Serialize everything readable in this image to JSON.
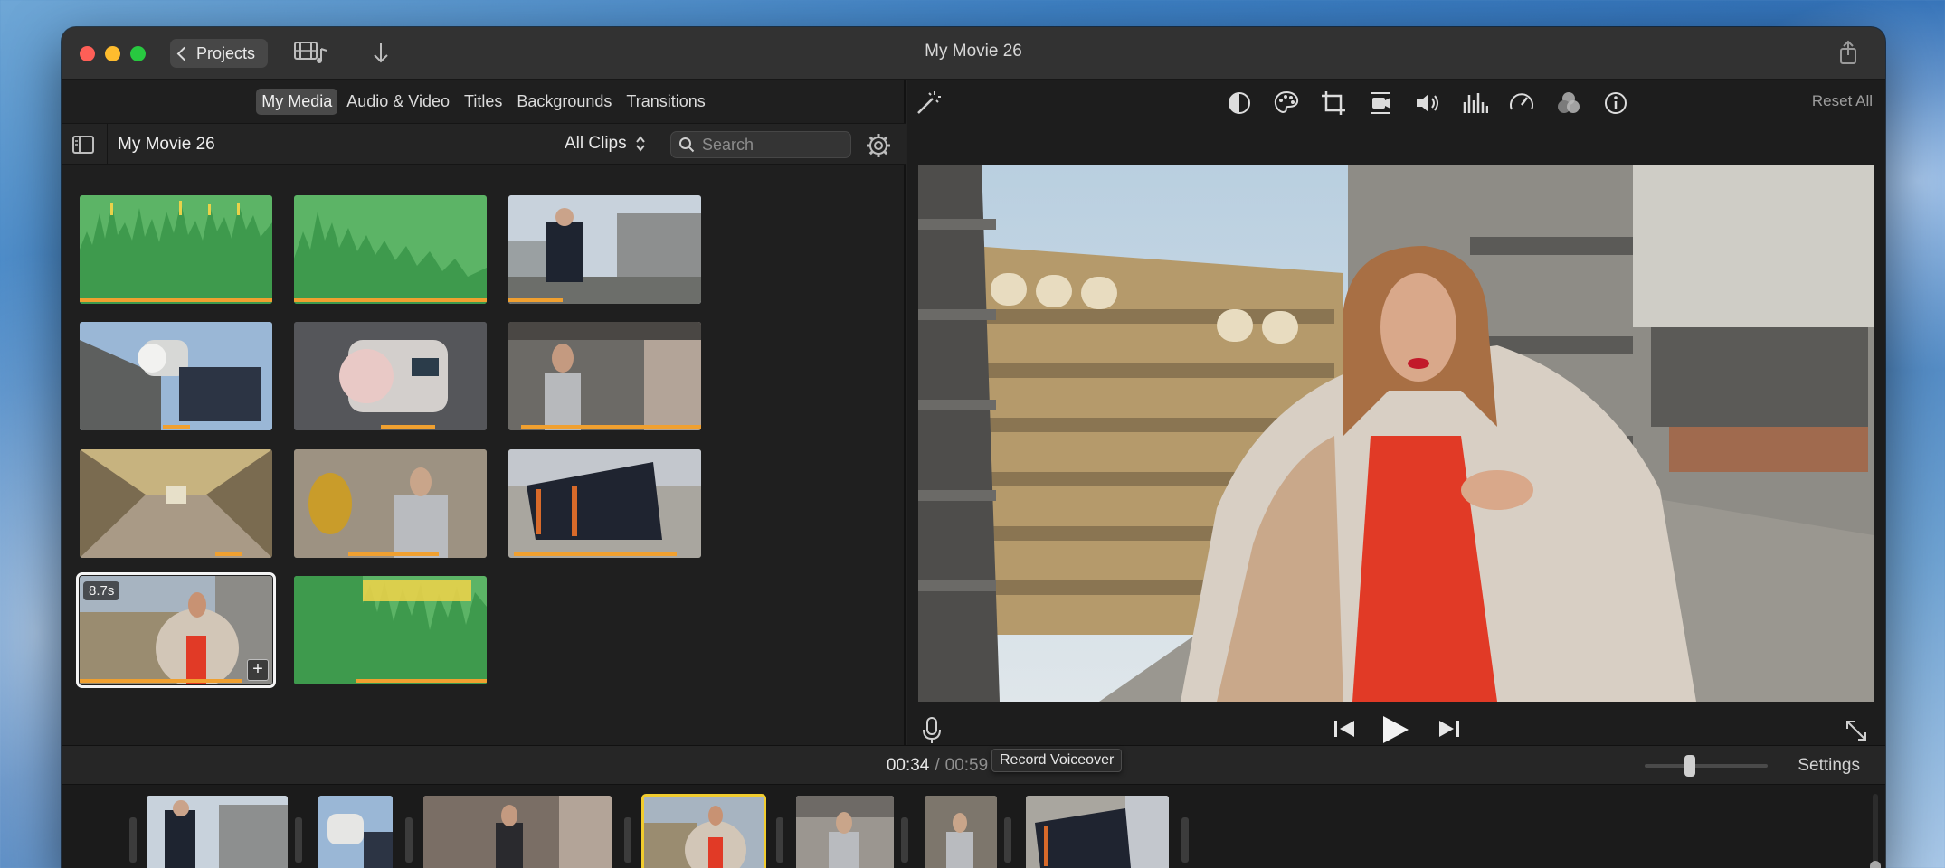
{
  "window": {
    "title": "My Movie 26"
  },
  "toolbar": {
    "projects_label": "Projects"
  },
  "browser": {
    "tabs": [
      {
        "label": "My Media",
        "active": true
      },
      {
        "label": "Audio & Video",
        "active": false
      },
      {
        "label": "Titles",
        "active": false
      },
      {
        "label": "Backgrounds",
        "active": false
      },
      {
        "label": "Transitions",
        "active": false
      }
    ],
    "library_title": "My Movie 26",
    "filter_label": "All Clips",
    "search_placeholder": "Search"
  },
  "media": {
    "selected_duration": "8.7s",
    "add_symbol": "+"
  },
  "viewer": {
    "reset_label": "Reset All",
    "tools": [
      "magic-wand-icon",
      "color-balance-icon",
      "color-palette-icon",
      "crop-icon",
      "stabilization-camera-icon",
      "volume-icon",
      "equalizer-icon",
      "speed-icon",
      "filter-icon",
      "info-icon"
    ],
    "tooltip": "Record Voiceover"
  },
  "timeline": {
    "current_time": "00:34",
    "separator": "/",
    "total_time": "00:59",
    "settings_label": "Settings",
    "zoom_level": 0.35
  },
  "colors": {
    "accent_selection": "#f1cc2e",
    "audio_green": "#5cb466",
    "usage_orange": "#f0a030",
    "audio_blue": "#2f72d6"
  }
}
